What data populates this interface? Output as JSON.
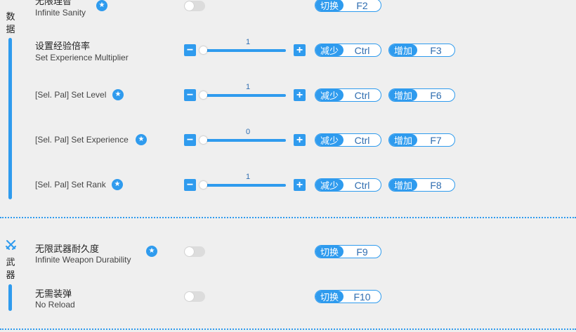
{
  "categories": {
    "data": {
      "chars": [
        "数",
        "据"
      ]
    },
    "weapon": {
      "chars": [
        "武",
        "器"
      ],
      "icon": "crossed-swords-icon"
    }
  },
  "rows": {
    "sanity": {
      "cn": "无限理智",
      "en": "Infinite Sanity",
      "hotkey": {
        "action": "切换",
        "key": "F2"
      }
    },
    "exp_mult": {
      "cn": "设置经验倍率",
      "en": "Set Experience Multiplier",
      "value": "1",
      "dec": {
        "action": "减少",
        "key": "Ctrl"
      },
      "inc": {
        "action": "增加",
        "key": "F3"
      }
    },
    "set_level": {
      "en": "[Sel. Pal] Set Level",
      "value": "1",
      "dec": {
        "action": "减少",
        "key": "Ctrl"
      },
      "inc": {
        "action": "增加",
        "key": "F6"
      }
    },
    "set_exp": {
      "en": "[Sel. Pal] Set Experience",
      "value": "0",
      "dec": {
        "action": "减少",
        "key": "Ctrl"
      },
      "inc": {
        "action": "增加",
        "key": "F7"
      }
    },
    "set_rank": {
      "en": "[Sel. Pal] Set Rank",
      "value": "1",
      "dec": {
        "action": "减少",
        "key": "Ctrl"
      },
      "inc": {
        "action": "增加",
        "key": "F8"
      }
    },
    "weapon_dur": {
      "cn": "无限武器耐久度",
      "en": "Infinite Weapon Durability",
      "hotkey": {
        "action": "切换",
        "key": "F9"
      }
    },
    "no_reload": {
      "cn": "无需装弹",
      "en": "No Reload",
      "hotkey": {
        "action": "切换",
        "key": "F10"
      }
    }
  },
  "symbols": {
    "minus": "−",
    "plus": "+",
    "star": "★"
  },
  "colors": {
    "accent": "#2f9bee",
    "background": "#efefef"
  }
}
